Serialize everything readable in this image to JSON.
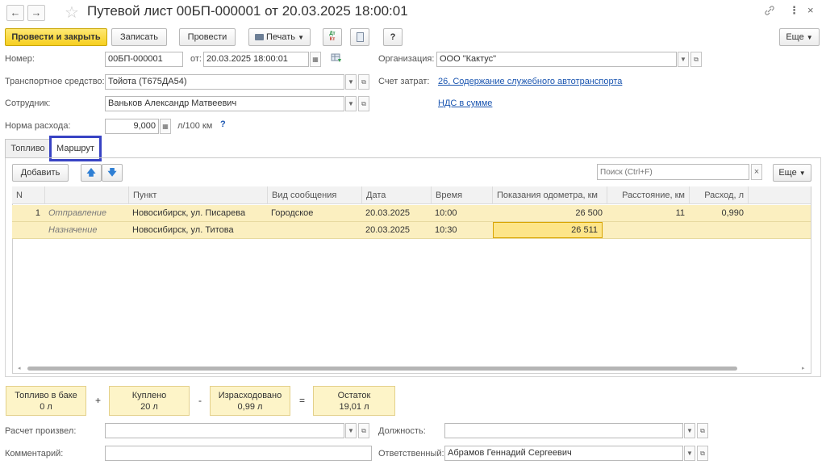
{
  "window": {
    "title": "Путевой лист 00БП-000001 от 20.03.2025 18:00:01",
    "close_glyph": "×"
  },
  "toolbar": {
    "post_close": "Провести и закрыть",
    "save": "Записать",
    "post": "Провести",
    "print": "Печать",
    "help": "?",
    "more": "Еще"
  },
  "header": {
    "number_label": "Номер:",
    "number_value": "00БП-000001",
    "from_label": "от:",
    "date_value": "20.03.2025 18:00:01",
    "org_label": "Организация:",
    "org_value": "ООО \"Кактус\"",
    "vehicle_label": "Транспортное средство:",
    "vehicle_value": "Тойота (Т675ДА54)",
    "cost_label": "Счет затрат:",
    "cost_link": "26, Содержание служебного автотранспорта",
    "employee_label": "Сотрудник:",
    "employee_value": "Ваньков Александр Матвеевич",
    "vat_link": "НДС в сумме",
    "norm_label": "Норма расхода:",
    "norm_value": "9,000",
    "norm_unit": "л/100 км",
    "norm_help": "?"
  },
  "tabs": [
    {
      "label": "Топливо",
      "active": false
    },
    {
      "label": "Маршрут",
      "active": true
    }
  ],
  "table_toolbar": {
    "add": "Добавить",
    "search_placeholder": "Поиск (Ctrl+F)",
    "clear": "×",
    "more": "Еще"
  },
  "table": {
    "columns": [
      "N",
      "",
      "Пункт",
      "Вид сообщения",
      "Дата",
      "Время",
      "Показания одометра, км",
      "Расстояние, км",
      "Расход, л"
    ],
    "rows": [
      {
        "n": "1",
        "type": "Отправление",
        "point": "Новосибирск, ул. Писарева",
        "kind": "Городское",
        "date": "20.03.2025",
        "time": "10:00",
        "odometer": "26 500",
        "distance": "11",
        "consumption": "0,990"
      },
      {
        "n": "",
        "type": "Назначение",
        "point": "Новосибирск, ул. Титова",
        "kind": "",
        "date": "20.03.2025",
        "time": "10:30",
        "odometer": "26 511",
        "distance": "",
        "consumption": ""
      }
    ]
  },
  "summary": {
    "in_tank_label": "Топливо в баке",
    "in_tank_value": "0 л",
    "plus": "+",
    "bought_label": "Куплено",
    "bought_value": "20 л",
    "minus": "-",
    "spent_label": "Израсходовано",
    "spent_value": "0,99 л",
    "equals": "=",
    "rest_label": "Остаток",
    "rest_value": "19,01 л"
  },
  "footer": {
    "calc_label": "Расчет произвел:",
    "calc_value": "",
    "position_label": "Должность:",
    "position_value": "",
    "comment_label": "Комментарий:",
    "comment_value": "",
    "responsible_label": "Ответственный:",
    "responsible_value": "Абрамов Геннадий Сергеевич"
  },
  "colors": {
    "primary_button": "#f6cf1f",
    "row_highlight": "#fbefc0",
    "link": "#1a55b0",
    "active_tab_border": "#3843c4"
  }
}
